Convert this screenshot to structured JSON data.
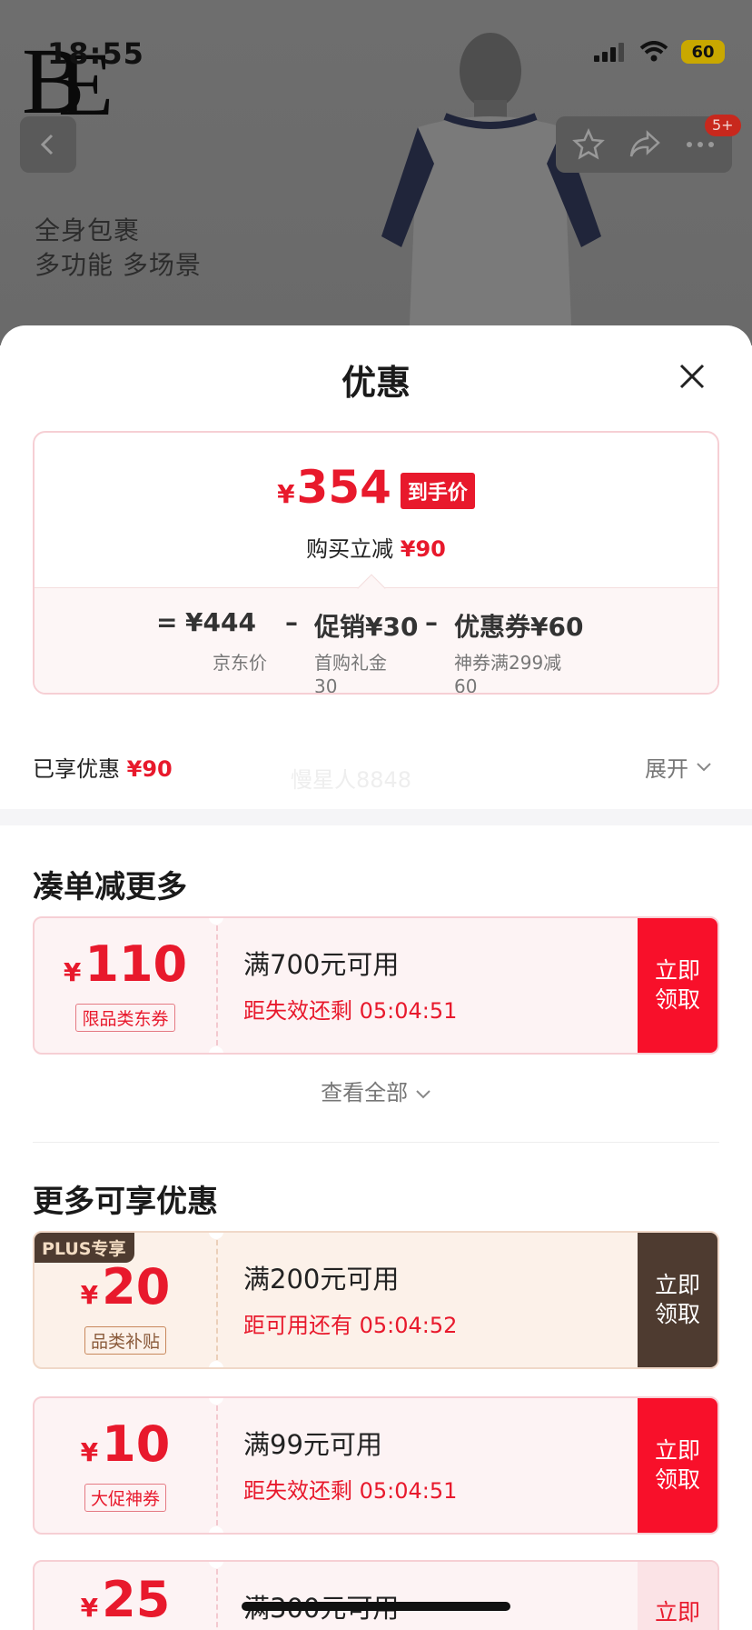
{
  "status_bar": {
    "time": "18:55",
    "battery": "60"
  },
  "nav": {
    "badge": "5+"
  },
  "product_promo": {
    "line1": "全身包裹",
    "line2": "多功能 多场景"
  },
  "sheet": {
    "title": "优惠"
  },
  "price_card": {
    "currency": "¥",
    "final_price": "354",
    "final_tag": "到手价",
    "reduce_label": "购买立减",
    "reduce_value": "¥90",
    "formula": {
      "equals": "=",
      "jd_price": "¥444",
      "minus1": "–",
      "promo": "促销¥30",
      "minus2": "–",
      "coupon": "优惠券¥60",
      "jd_price_label": "京东价",
      "promo_label": "首购礼金\n30",
      "coupon_label": "神券满299减\n60"
    }
  },
  "enjoyed": {
    "label": "已享优惠",
    "value": "¥90",
    "expand": "展开"
  },
  "watermark": "慢星人8848",
  "section_more_order": {
    "title": "凑单减更多",
    "view_all": "查看全部"
  },
  "section_more_offers": {
    "title": "更多可享优惠"
  },
  "coupons": [
    {
      "amount": "110",
      "tag": "限品类东券",
      "condition": "满700元可用",
      "time": "距失效还剩 05:04:51",
      "button": "立即领取"
    },
    {
      "plus_label": "PLUS专享",
      "amount": "20",
      "tag": "品类补贴",
      "condition": "满200元可用",
      "time": "距可用还有 05:04:52",
      "button": "立即领取"
    },
    {
      "amount": "10",
      "tag": "大促神券",
      "condition": "满99元可用",
      "time": "距失效还剩 05:04:51",
      "button": "立即领取"
    },
    {
      "amount": "25",
      "condition": "满300元可用",
      "button": "立即"
    }
  ],
  "colors": {
    "accent_red": "#e8192c",
    "plus_brown": "#4e3b30"
  }
}
